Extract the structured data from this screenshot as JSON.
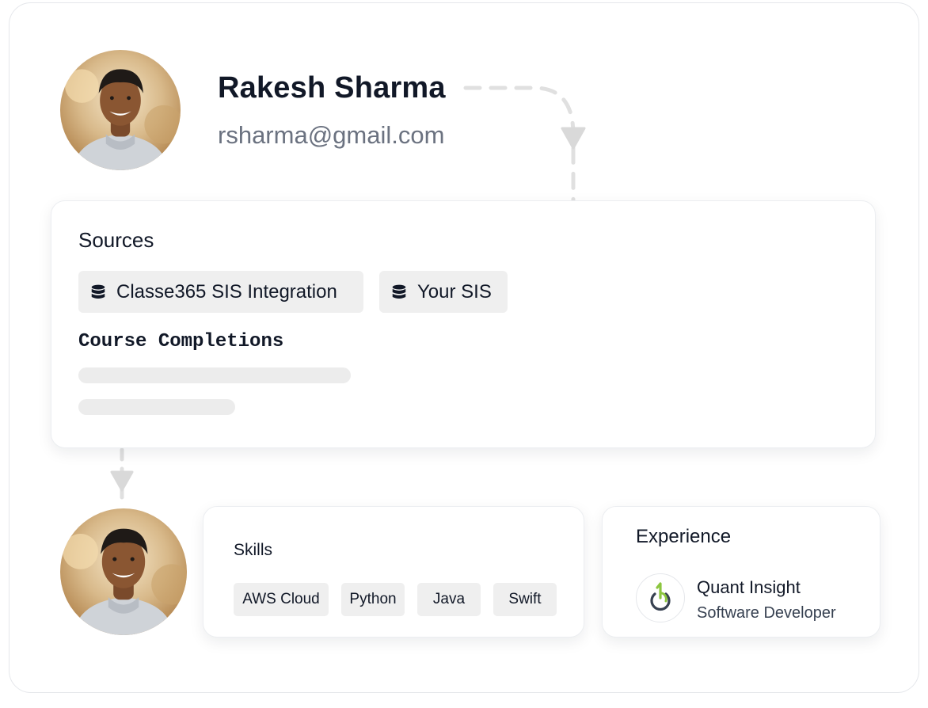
{
  "profile": {
    "name": "Rakesh Sharma",
    "email": "rsharma@gmail.com"
  },
  "sources": {
    "title": "Sources",
    "items": [
      {
        "label": "Classe365 SIS Integration",
        "icon": "database-icon"
      },
      {
        "label": "Your SIS",
        "icon": "database-icon"
      }
    ],
    "course_completions_title": "Course Completions"
  },
  "skills": {
    "title": "Skills",
    "items": [
      "AWS Cloud",
      "Python",
      "Java",
      "Swift"
    ]
  },
  "experience": {
    "title": "Experience",
    "company": "Quant Insight",
    "role": "Software Developer",
    "logo": "quant-insight-logo"
  },
  "colors": {
    "logo_green": "#8cc63f",
    "logo_dark": "#374151",
    "chip_bg": "#efefef",
    "connector": "#e0e0e0",
    "email_text": "#6b7280"
  }
}
